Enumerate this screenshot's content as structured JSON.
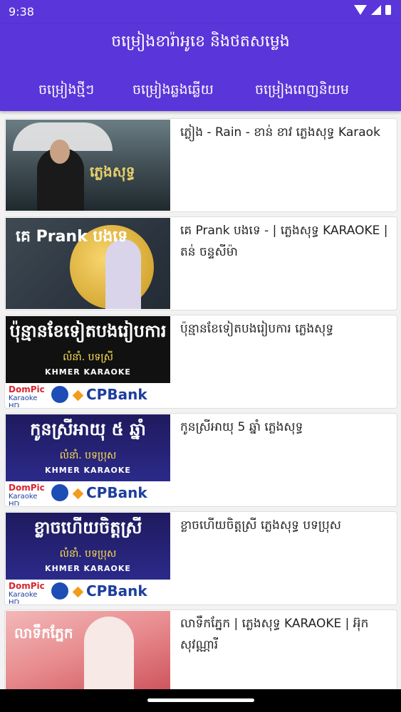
{
  "status": {
    "time": "9:38"
  },
  "appbar": {
    "title": "ចម្រៀងខារ៉ាអូខេ និងថតសម្លេង"
  },
  "tabs": [
    {
      "label": "ចម្រៀងថ្មីៗ"
    },
    {
      "label": "ចម្រៀងឆ្លងឆ្លើយ"
    },
    {
      "label": "ចម្រៀងពេញនិយម"
    }
  ],
  "songs": [
    {
      "title": "ភ្លៀង - Rain - ខាន់ ខាវ ភ្លេងសុទ្ធ Karaok",
      "thumb_text": "ភ្លេងសុទ្ធ"
    },
    {
      "title": "គេ Prank បងទេ - | ភ្លេងសុទ្ធ KARAOKE | តន់ ចន្ទសីម៉ា",
      "thumb_text": "គេ Prank បងទេ"
    },
    {
      "title": "ប៉ុន្មានខែទៀតបងរៀបការ ភ្លេងសុទ្ធ",
      "thumb_big": "ប៉ុន្មានខែទៀតបងរៀបការ",
      "thumb_auth": "លំនាំ. បទស្រី",
      "thumb_kk": "KHMER KARAOKE",
      "dom1": "DomPic",
      "dom2": "Karaoke HD",
      "bank": "CPBank"
    },
    {
      "title": "កូនស្រីអាយុ 5 ឆ្នាំ ភ្លេងសុទ្ធ",
      "thumb_big": "កូនស្រីអាយុ ៥ ឆ្នាំ",
      "thumb_auth": "លំនាំ. បទប្រុស",
      "thumb_kk": "KHMER KARAOKE",
      "dom1": "DomPic",
      "dom2": "Karaoke HD",
      "bank": "CPBank"
    },
    {
      "title": "ខ្លាចហើយចិត្តស្រី ភ្លេងសុទ្ធ បទប្រុស",
      "thumb_big": "ខ្លាចហើយចិត្តស្រី",
      "thumb_auth": "លំនាំ. បទប្រុស",
      "thumb_kk": "KHMER KARAOKE",
      "dom1": "DomPic",
      "dom2": "Karaoke HD",
      "bank": "CPBank"
    },
    {
      "title": "លាទឹកភ្នែក | ភ្លេងសុទ្ធ KARAOKE | អ៊ុក សុវណ្ណារី",
      "thumb_text": "លាទឹកភ្នែក"
    }
  ],
  "colors": {
    "primary": "#5a35d9"
  }
}
